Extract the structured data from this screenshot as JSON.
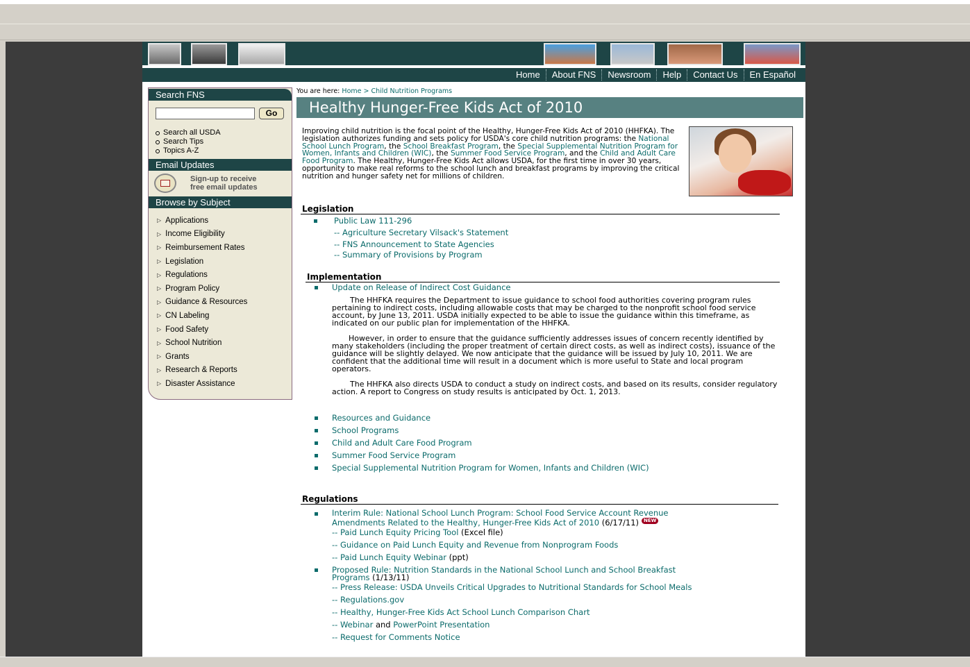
{
  "nav": {
    "items": [
      "Home",
      "About FNS",
      "Newsroom",
      "Help",
      "Contact Us",
      "En Español"
    ]
  },
  "sidebar": {
    "search_title": "Search FNS",
    "go_label": "Go",
    "quick_links": [
      "Search all USDA",
      "Search Tips",
      "Topics A-Z"
    ],
    "email_title": "Email Updates",
    "email_line1": "Sign-up to receive",
    "email_line2": "free email updates",
    "browse_title": "Browse by Subject",
    "subjects": [
      "Applications",
      "Income Eligibility",
      "Reimbursement Rates",
      "Legislation",
      "Regulations",
      "Program Policy",
      "Guidance & Resources",
      "CN Labeling",
      "Food Safety",
      "School Nutrition",
      "Grants",
      "Research & Reports",
      "Disaster Assistance"
    ]
  },
  "breadcrumb": {
    "prefix": "You are here:",
    "home": "Home",
    "sep": " > ",
    "current": "Child Nutrition Programs"
  },
  "page_title": "Healthy Hunger-Free Kids Act of 2010",
  "intro": {
    "t1": "Improving child nutrition is the focal point of the Healthy, Hunger-Free Kids Act of 2010 (HHFKA). The legislation authorizes funding and sets policy for USDA's core child nutrition programs: the ",
    "l1": "National School Lunch Program",
    "t2": ", the ",
    "l2": "School Breakfast Program",
    "t3": ", the ",
    "l3": "Special Supplemental Nutrition Program for Women, Infants and Children (WIC)",
    "t4": ", the ",
    "l4": "Summer Food Service Program",
    "t5": ", and the ",
    "l5": "Child and Adult Care Food Program",
    "t6": ". The Healthy, Hunger-Free Kids Act allows USDA, for the first time in over 30 years, opportunity to make real reforms to the school lunch and breakfast programs by improving the critical nutrition and hunger safety net for millions of children."
  },
  "legislation": {
    "heading": "Legislation",
    "public_law": "Public Law 111-296",
    "subs": [
      "-- Agriculture Secretary Vilsack's Statement",
      "-- FNS Announcement to State Agencies",
      "-- Summary of Provisions by Program"
    ]
  },
  "implementation": {
    "heading": "Implementation",
    "update_link": "Update on Release of Indirect Cost Guidance",
    "para1": "The HHFKA requires the Department to issue guidance to school food authorities covering program rules pertaining to indirect costs, including allowable costs that may be charged to the nonprofit school food service account, by June 13, 2011.  USDA initially expected to be able to issue the guidance within this timeframe, as indicated on our public plan for implementation of the HHFKA.",
    "para2": "However, in order to ensure that the guidance sufficiently addresses issues of concern recently identified by many stakeholders (including the proper treatment of certain direct costs, as well as indirect costs),  issuance of the guidance will be slightly delayed.  We now anticipate that the guidance will be issued by July 10, 2011.  We are confident that the additional time will result in a document which is more useful to State and local program operators.",
    "para3": "The HHFKA also directs USDA to conduct a study on indirect costs, and based on its results, consider regulatory action.  A report to Congress on study results is anticipated by Oct. 1, 2013.",
    "links": [
      "Resources and Guidance",
      "School Programs",
      "Child and Adult Care Food Program",
      "Summer Food Service Program",
      "Special Supplemental Nutrition Program for Women, Infants and Children (WIC)"
    ]
  },
  "regulations": {
    "heading": "Regulations",
    "interim_line1": "Interim Rule: National School Lunch Program: School Food Service Account Revenue",
    "interim_line2": "Amendments Related to the Healthy, Hunger-Free Kids Act of 2010",
    "interim_date": " (6/17/11)",
    "new_badge": "NEW",
    "pricing_tool": "-- Paid Lunch Equity Pricing Tool",
    "pricing_suffix": " (Excel file)",
    "guidance": "-- Guidance on Paid Lunch Equity and Revenue from Nonprogram Foods",
    "webinar": "-- Paid Lunch Equity Webinar",
    "webinar_suffix": " (ppt)",
    "proposed_line1": "Proposed Rule: Nutrition Standards in the National School Lunch and School Breakfast",
    "proposed_line2": "Programs",
    "proposed_date": "  (1/13/11)",
    "press_release": "-- Press Release: USDA Unveils Critical Upgrades to Nutritional Standards for School Meals",
    "regs_gov": "-- Regulations.gov",
    "comparison": "-- Healthy, Hunger-Free Kids Act School Lunch Comparison Chart",
    "webinar2_prefix": "-- ",
    "webinar2": "Webinar",
    "and": " and ",
    "powerpoint": "PowerPoint Presentation",
    "request": "-- Request for Comments Notice"
  },
  "colors": {
    "header_bg": "#1e4546",
    "title_bg": "#578181",
    "link": "#0b6b6b",
    "sidebar_bg": "#ece9d8"
  }
}
